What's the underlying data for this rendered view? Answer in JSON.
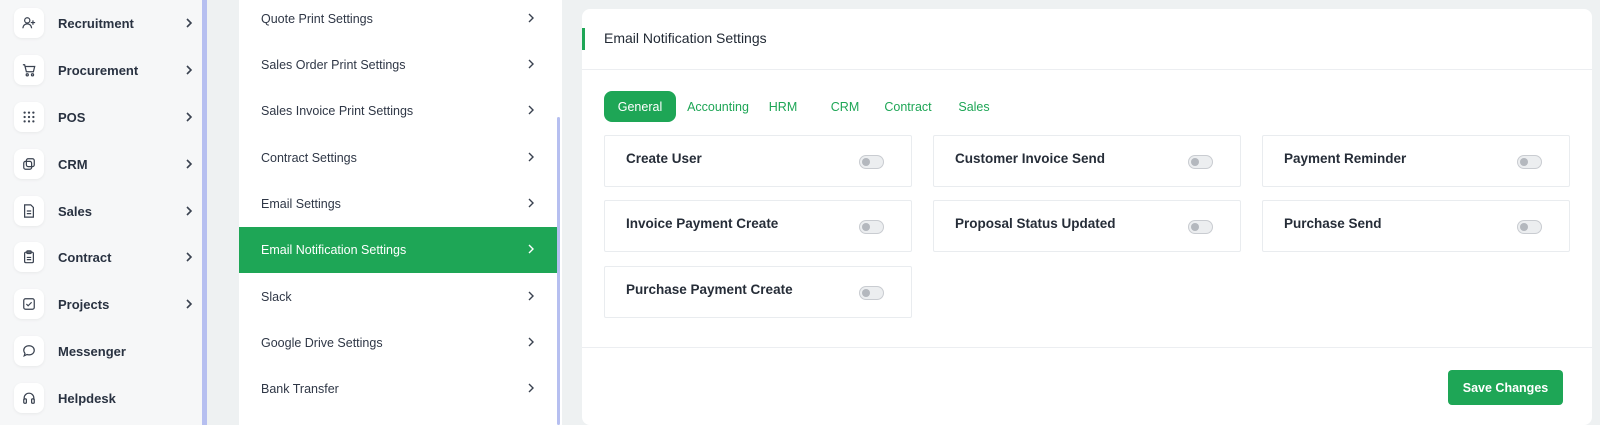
{
  "sidebar": {
    "items": [
      {
        "label": "Recruitment",
        "icon": "user-plus-icon"
      },
      {
        "label": "Procurement",
        "icon": "cart-icon"
      },
      {
        "label": "POS",
        "icon": "grid-icon"
      },
      {
        "label": "CRM",
        "icon": "layers-icon"
      },
      {
        "label": "Sales",
        "icon": "document-icon"
      },
      {
        "label": "Contract",
        "icon": "clipboard-icon"
      },
      {
        "label": "Projects",
        "icon": "checkbox-icon"
      },
      {
        "label": "Messenger",
        "icon": "chat-icon"
      },
      {
        "label": "Helpdesk",
        "icon": "headset-icon"
      }
    ]
  },
  "settings_list": {
    "items": [
      {
        "label": "Quote Print Settings"
      },
      {
        "label": "Sales Order Print Settings"
      },
      {
        "label": "Sales Invoice Print Settings"
      },
      {
        "label": "Contract Settings"
      },
      {
        "label": "Email Settings"
      },
      {
        "label": "Email Notification Settings",
        "active": true
      },
      {
        "label": "Slack"
      },
      {
        "label": "Google Drive Settings"
      },
      {
        "label": "Bank Transfer"
      }
    ]
  },
  "main": {
    "title": "Email Notification Settings",
    "tabs": [
      {
        "label": "General",
        "active": true
      },
      {
        "label": "Accounting"
      },
      {
        "label": "HRM"
      },
      {
        "label": "CRM"
      },
      {
        "label": "Contract"
      },
      {
        "label": "Sales"
      }
    ],
    "notifications": [
      {
        "label": "Create User",
        "enabled": false
      },
      {
        "label": "Customer Invoice Send",
        "enabled": false
      },
      {
        "label": "Payment Reminder",
        "enabled": false
      },
      {
        "label": "Invoice Payment Create",
        "enabled": false
      },
      {
        "label": "Proposal Status Updated",
        "enabled": false
      },
      {
        "label": "Purchase Send",
        "enabled": false
      },
      {
        "label": "Purchase Payment Create",
        "enabled": false
      }
    ],
    "save_label": "Save Changes"
  },
  "colors": {
    "accent": "#1ea656",
    "scrollbar": "#b6bff0"
  }
}
